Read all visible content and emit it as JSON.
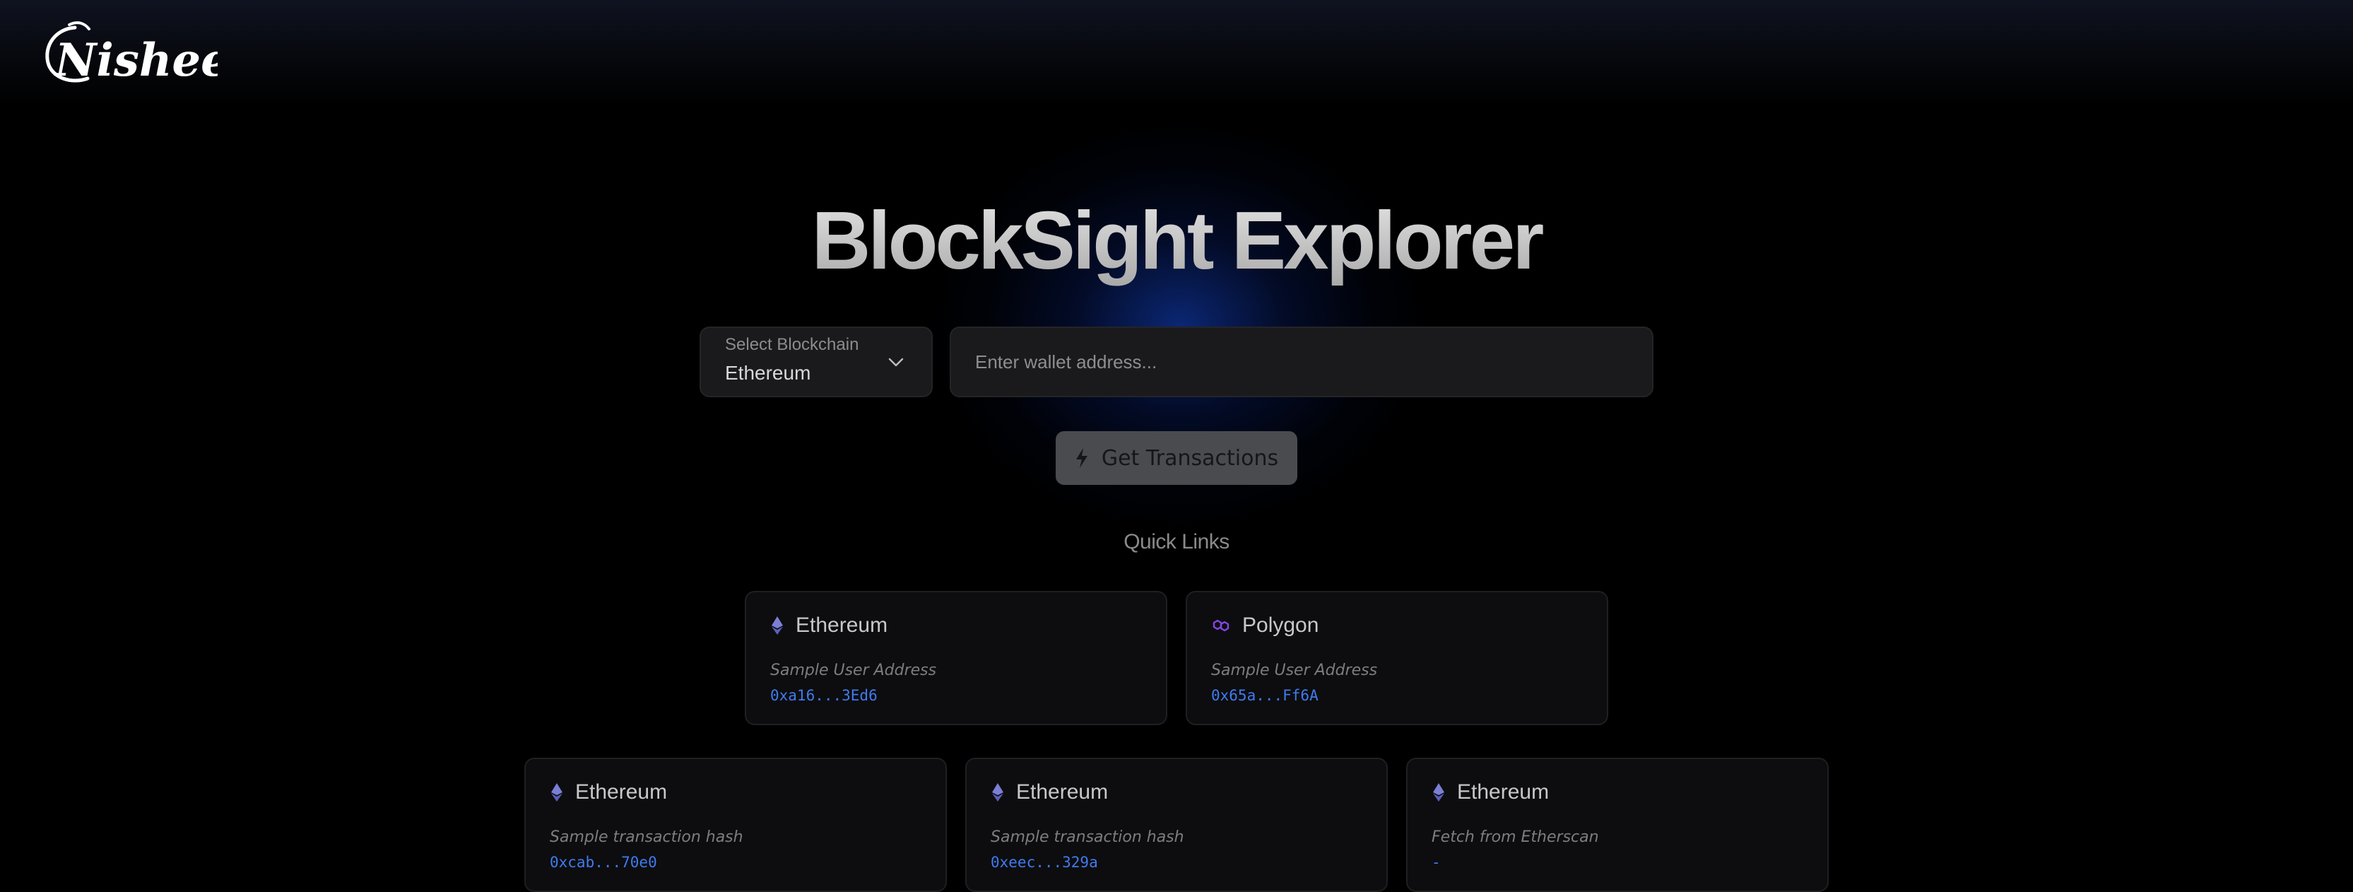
{
  "brand": {
    "logo_text": "Nisheet"
  },
  "hero": {
    "title": "BlockSight Explorer"
  },
  "search": {
    "chain_label": "Select Blockchain",
    "chain_value": "Ethereum",
    "address_placeholder": "Enter wallet address...",
    "address_value": "",
    "button_label": "Get Transactions"
  },
  "quick_links": {
    "title": "Quick Links",
    "items": [
      {
        "chain": "Ethereum",
        "icon": "ethereum-icon",
        "description": "Sample User Address",
        "value": "0xa16...3Ed6"
      },
      {
        "chain": "Polygon",
        "icon": "polygon-icon",
        "description": "Sample User Address",
        "value": "0x65a...Ff6A"
      },
      {
        "chain": "Ethereum",
        "icon": "ethereum-icon",
        "description": "Sample transaction hash",
        "value": "0xcab...70e0"
      },
      {
        "chain": "Ethereum",
        "icon": "ethereum-icon",
        "description": "Sample transaction hash",
        "value": "0xeec...329a"
      },
      {
        "chain": "Ethereum",
        "icon": "ethereum-icon",
        "description": "Fetch from Etherscan",
        "value": "-"
      }
    ]
  },
  "colors": {
    "background": "#000000",
    "accent_blue": "#3f7bf0",
    "ethereum_icon": "#7b7fd6",
    "polygon_icon": "#8247e5",
    "button_bg": "#4a4b4f"
  }
}
